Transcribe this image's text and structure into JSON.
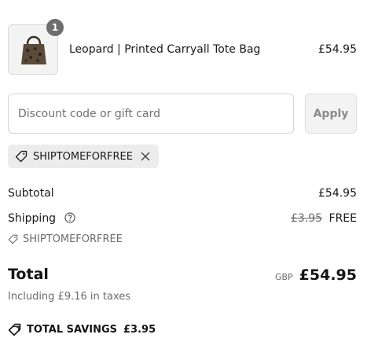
{
  "product": {
    "quantity": "1",
    "name": "Leopard | Printed Carryall Tote Bag",
    "price": "£54.95",
    "image_icon": "tote-bag-image"
  },
  "discount": {
    "placeholder": "Discount code or gift card",
    "value": "",
    "apply_label": "Apply",
    "applied_code": "SHIPTOMEFORFREE"
  },
  "summary": {
    "subtotal_label": "Subtotal",
    "subtotal_value": "£54.95",
    "shipping_label": "Shipping",
    "shipping_original": "£3.95",
    "shipping_value": "FREE",
    "shipping_code": "SHIPTOMEFORFREE",
    "total_label": "Total",
    "currency": "GBP",
    "total_value": "£54.95",
    "taxes_note": "Including £9.16 in taxes",
    "savings_label": "TOTAL SAVINGS",
    "savings_value": "£3.95"
  },
  "colors": {
    "chip_background": "#ececec",
    "muted_text": "#6b6b6b",
    "badge": "#6e6e6e"
  }
}
